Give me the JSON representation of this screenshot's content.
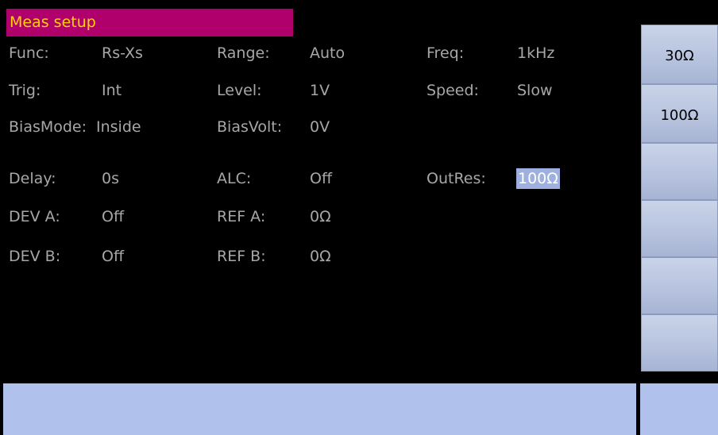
{
  "title": "Meas setup",
  "params": {
    "func_label": "Func:",
    "func_value": "Rs-Xs",
    "range_label": "Range:",
    "range_value": "Auto",
    "freq_label": "Freq:",
    "freq_value": "1kHz",
    "trig_label": "Trig:",
    "trig_value": "Int",
    "level_label": "Level:",
    "level_value": "1V",
    "speed_label": "Speed:",
    "speed_value": "Slow",
    "biasmode_label": "BiasMode:",
    "biasmode_value": "Inside",
    "biasvolt_label": "BiasVolt:",
    "biasvolt_value": "0V",
    "delay_label": "Delay:",
    "delay_value": "0s",
    "alc_label": "ALC:",
    "alc_value": "Off",
    "outres_label": "OutRes:",
    "outres_value": "100Ω",
    "deva_label": "DEV A:",
    "deva_value": "Off",
    "refa_label": "REF A:",
    "refa_value": "0Ω",
    "devb_label": "DEV B:",
    "devb_value": "Off",
    "refb_label": "REF B:",
    "refb_value": "0Ω"
  },
  "softkeys": [
    "30Ω",
    "100Ω",
    "",
    "",
    "",
    ""
  ],
  "status_text": "",
  "colors": {
    "title_bg": "#b0006b",
    "title_text": "#ffd400",
    "value_text": "#a7a7a7",
    "selected_bg": "#9db0e0",
    "status_bar_bg": "#b0c2ec",
    "softkey_bg": "#b8c4df"
  }
}
